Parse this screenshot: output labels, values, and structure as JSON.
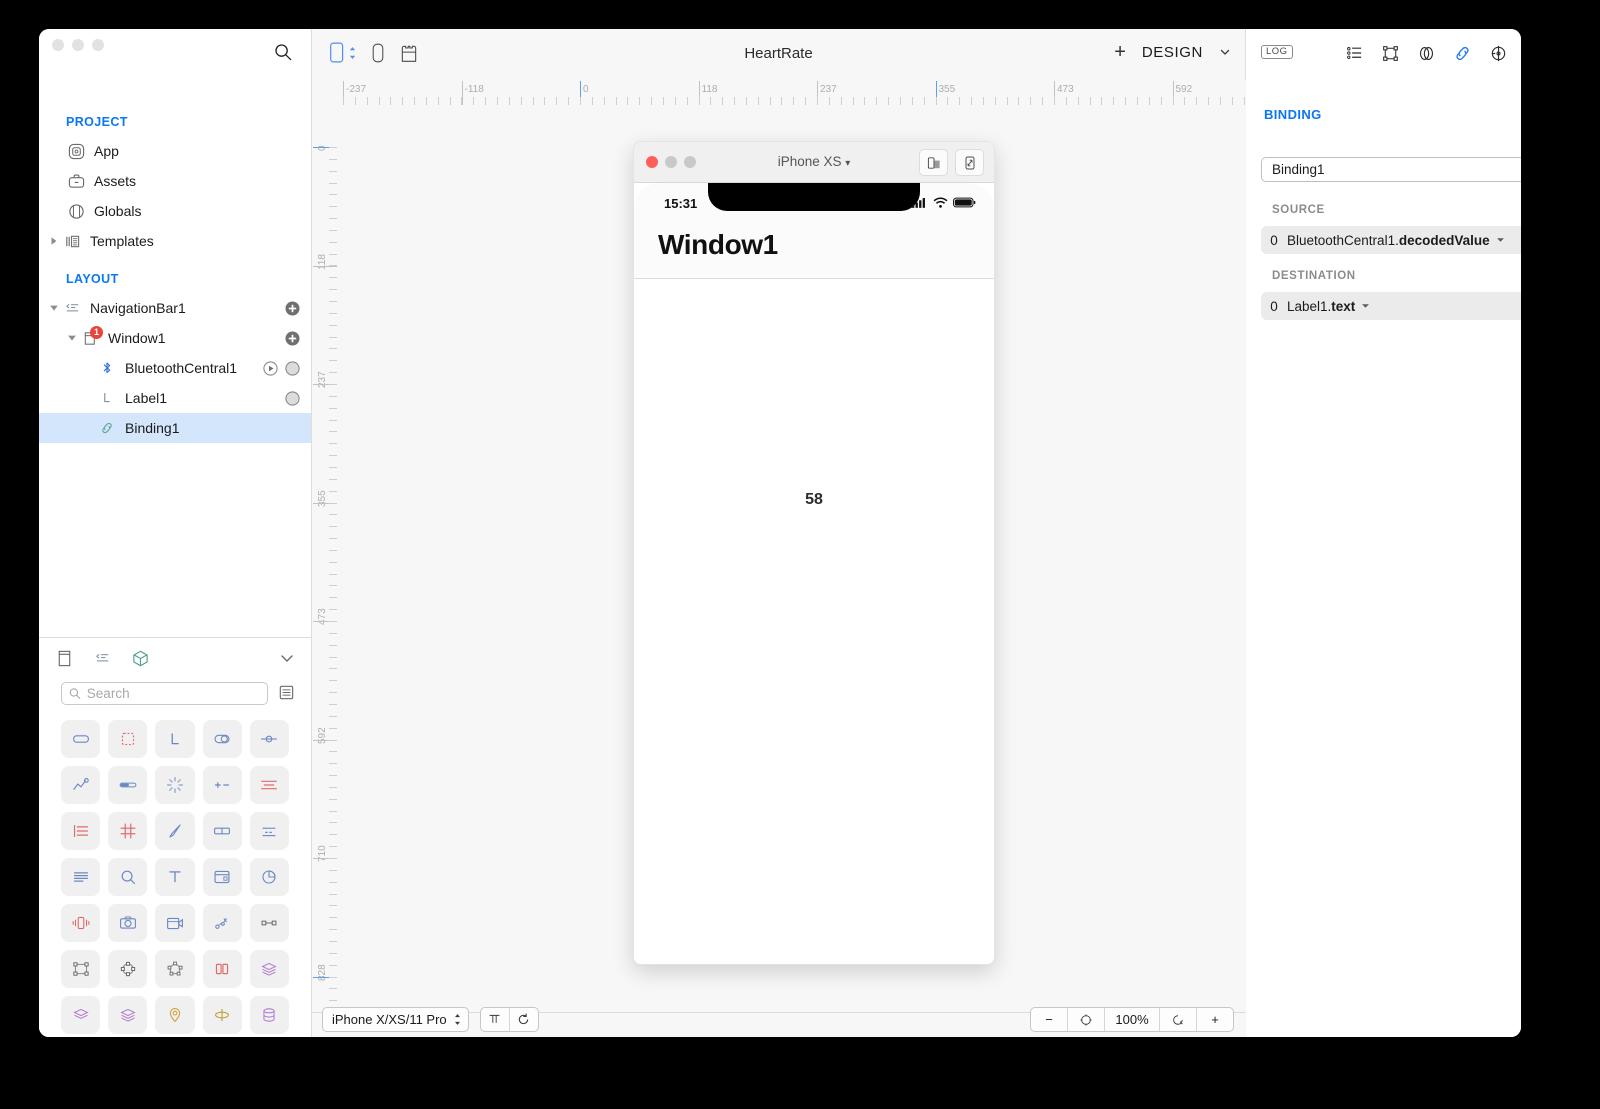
{
  "sidebar": {
    "search_icon": "search-icon",
    "project": {
      "heading": "PROJECT",
      "items": [
        {
          "label": "App",
          "icon": "app-icon"
        },
        {
          "label": "Assets",
          "icon": "assets-briefcase-icon"
        },
        {
          "label": "Globals",
          "icon": "globals-cylinder-icon"
        },
        {
          "label": "Templates",
          "icon": "templates-icon"
        }
      ]
    },
    "layout": {
      "heading": "LAYOUT",
      "items": [
        {
          "label": "NavigationBar1",
          "icon": "navigationbar-icon",
          "badge": "",
          "selected": false
        },
        {
          "label": "Window1",
          "icon": "window-icon",
          "badge": "1",
          "selected": false
        },
        {
          "label": "BluetoothCentral1",
          "icon": "bluetooth-icon",
          "badge": "",
          "selected": false
        },
        {
          "label": "Label1",
          "icon": "label-L-icon",
          "badge": "",
          "selected": false
        },
        {
          "label": "Binding1",
          "icon": "binding-link-icon",
          "badge": "",
          "selected": true
        }
      ]
    }
  },
  "library": {
    "tabs": [
      "components-tab-icon",
      "layouts-tab-icon",
      "objects-tab-icon"
    ],
    "collapse_icon": "chevron-down-icon",
    "search_placeholder": "Search",
    "search_value": "",
    "list_toggle_icon": "list-view-icon",
    "palette": [
      "button-icon",
      "placeholder-icon",
      "label-icon",
      "switch-icon",
      "slider-icon",
      "chart-icon",
      "progress-icon",
      "activity-indicator-icon",
      "stepper-icon",
      "segmented-icon",
      "list-icon",
      "grid-icon",
      "pen-icon",
      "tabbar-icon",
      "picker-icon",
      "menu-icon",
      "search-field-icon",
      "text-icon",
      "card-icon",
      "pie-chart-icon",
      "vibration-icon",
      "camera-icon",
      "video-icon",
      "scatter-icon",
      "connector-icon",
      "frame-icon",
      "circle-path-icon",
      "polygon-path-icon",
      "split-icon",
      "stack-icon",
      "layer-icon",
      "layers-icon",
      "location-pin-icon",
      "orbit-icon",
      "database-icon"
    ]
  },
  "canvas": {
    "toolbar": {
      "left_icons": [
        "device-selector-icon",
        "phone-icon",
        "template-icon"
      ],
      "title": "HeartRate",
      "plus_label": "+",
      "mode_label": "DESIGN",
      "mode_chevron": "chevron-down-icon"
    },
    "ruler_h": [
      "-237",
      "-118",
      "0",
      "118",
      "237",
      "355",
      "473",
      "592"
    ],
    "ruler_v": [
      "0",
      "118",
      "237",
      "355",
      "473",
      "592",
      "710",
      "828"
    ],
    "bottom": {
      "device_select": "iPhone X/XS/11 Pro",
      "device_select_icon": "stepper-icon",
      "tool_buttons": [
        "align-icon",
        "refresh-icon"
      ],
      "zoom_minus": "−",
      "zoom_fit_icon": "fit-icon",
      "zoom_level": "100%",
      "zoom_actual_icon": "actual-size-icon",
      "zoom_plus": "+"
    }
  },
  "device": {
    "titlebar": {
      "title": "iPhone XS",
      "caret": "▾",
      "buttons": [
        "split-view-icon",
        "resize-icon"
      ],
      "traffic": [
        "#ff5f57",
        "#c9c9c9",
        "#c9c9c9"
      ]
    },
    "status_bar": {
      "time": "15:31",
      "icons": [
        "cellular-icon",
        "wifi-icon",
        "battery-icon"
      ]
    },
    "navbar_title": "Window1",
    "label1_value": "58"
  },
  "inspector": {
    "log_badge": "LOG",
    "icons": [
      "list-inspector-icon",
      "layout-inspector-icon",
      "appearance-inspector-icon",
      "binding-inspector-icon",
      "preview-inspector-icon"
    ],
    "section_title": "BINDING",
    "binding_select_value": "Binding1",
    "source": {
      "label": "SOURCE",
      "index": "0",
      "object": "BluetoothCentral1.",
      "property": "decodedValue",
      "caret": "▾"
    },
    "destination": {
      "label": "DESTINATION",
      "index": "0",
      "object": "Label1.",
      "property": "text",
      "caret": "▾"
    }
  },
  "colors": {
    "accent_blue": "#0a78f0",
    "selection_blue": "#d3e6fb",
    "badge_red": "#e8443a"
  }
}
